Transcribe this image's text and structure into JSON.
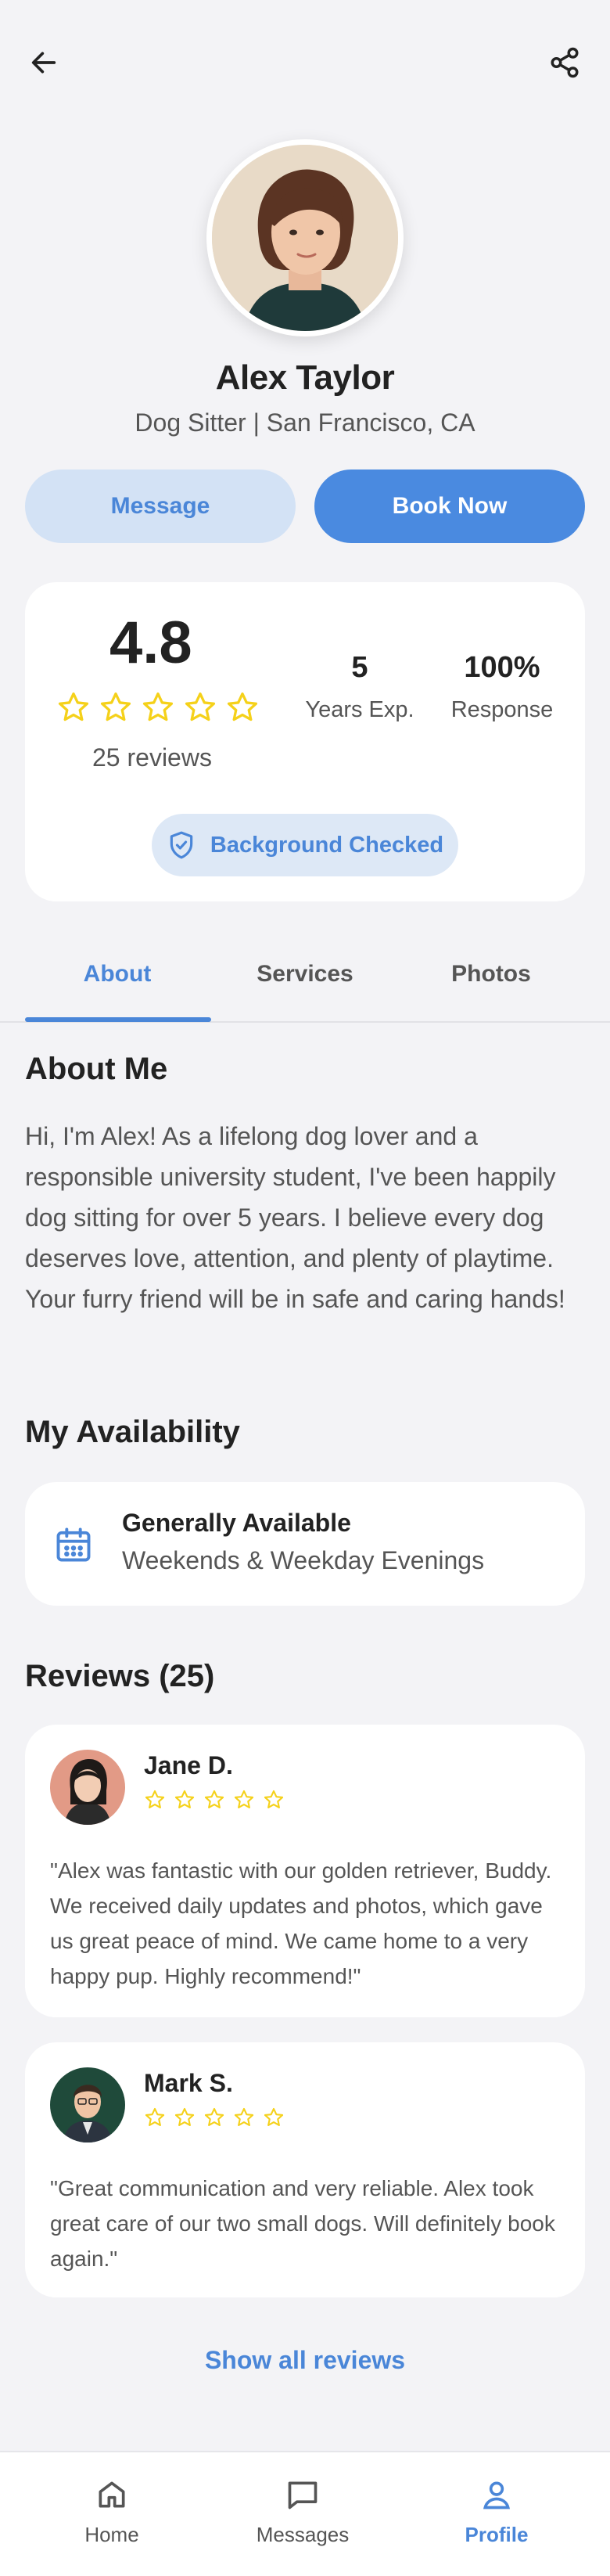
{
  "header": {
    "back_icon": "arrow-left-icon",
    "share_icon": "share-icon"
  },
  "profile": {
    "name": "Alex Taylor",
    "subtitle": "Dog Sitter | San Francisco, CA"
  },
  "actions": {
    "message_label": "Message",
    "book_label": "Book Now"
  },
  "stats": {
    "rating": "4.8",
    "rating_stars": 5,
    "reviews_count": "25 reviews",
    "years_value": "5",
    "years_label": "Years Exp.",
    "response_value": "100%",
    "response_label": "Response",
    "badge_label": "Background Checked"
  },
  "tabs": [
    {
      "label": "About",
      "active": true
    },
    {
      "label": "Services",
      "active": false
    },
    {
      "label": "Photos",
      "active": false
    }
  ],
  "about": {
    "title": "About Me",
    "text": "Hi, I'm Alex! As a lifelong dog lover and a responsible university student, I've been happily dog sitting for over 5 years. I believe every dog deserves love, attention, and plenty of playtime. Your furry friend will be in safe and caring hands!"
  },
  "availability": {
    "title": "My Availability",
    "main": "Generally Available",
    "sub": "Weekends & Weekday Evenings"
  },
  "reviews": {
    "title": "Reviews (25)",
    "items": [
      {
        "name": "Jane D.",
        "stars": 5,
        "text": "\"Alex was fantastic with our golden retriever, Buddy. We received daily updates and photos, which gave us great peace of mind. We came home to a very happy pup. Highly recommend!\""
      },
      {
        "name": "Mark S.",
        "stars": 5,
        "text": "\"Great communication and very reliable. Alex took great care of our two small dogs. Will definitely book again.\""
      }
    ],
    "show_all": "Show all reviews"
  },
  "nav": {
    "items": [
      {
        "label": "Home",
        "icon": "home-icon",
        "active": false
      },
      {
        "label": "Messages",
        "icon": "message-icon",
        "active": false
      },
      {
        "label": "Profile",
        "icon": "user-icon",
        "active": true
      }
    ]
  },
  "colors": {
    "accent": "#4a86d8",
    "star": "#f5d11a",
    "background": "#f3f3f6"
  }
}
